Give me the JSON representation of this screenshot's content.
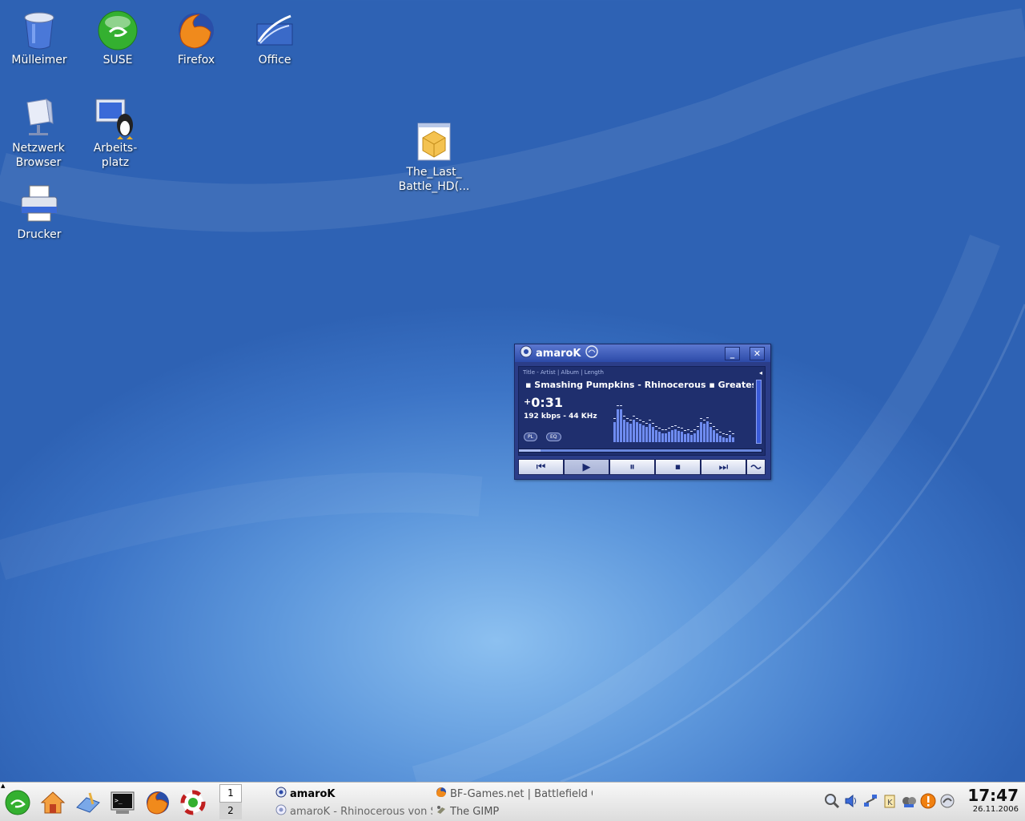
{
  "desktop_icons": [
    {
      "label": "Mülleimer",
      "icon": "trash-icon"
    },
    {
      "label": "SUSE",
      "icon": "suse-icon"
    },
    {
      "label": "Firefox",
      "icon": "firefox-icon"
    },
    {
      "label": "Office",
      "icon": "office-icon"
    },
    {
      "label": "Netzwerk\nBrowser",
      "icon": "network-browser-icon"
    },
    {
      "label": "Arbeits-\nplatz",
      "icon": "workstation-icon"
    },
    {
      "label": "Drucker",
      "icon": "printer-icon"
    },
    {
      "label": "The_Last_\nBattle_HD(...",
      "icon": "package-file-icon"
    }
  ],
  "amarok": {
    "title": "amaroK",
    "minimize": "_",
    "close": "✕",
    "columns": "Title - Artist | Album | Length",
    "track": "▪  Smashing Pumpkins - Rhinocerous  ▪  Greatest Hit",
    "time_prefix": "+",
    "time": "0:31",
    "bitrate": "192 kbps - 44 KHz",
    "pl_label": "PL",
    "eq_label": "EQ",
    "progress_fraction": 0.09,
    "analyzer_levels": [
      0.5,
      0.82,
      0.82,
      0.55,
      0.5,
      0.45,
      0.55,
      0.5,
      0.45,
      0.42,
      0.38,
      0.45,
      0.38,
      0.3,
      0.25,
      0.22,
      0.22,
      0.25,
      0.3,
      0.32,
      0.28,
      0.25,
      0.2,
      0.22,
      0.18,
      0.22,
      0.3,
      0.5,
      0.45,
      0.52,
      0.38,
      0.3,
      0.22,
      0.15,
      0.12,
      0.1,
      0.18,
      0.12
    ],
    "controls": [
      "⏮",
      "▶",
      "⏸",
      "⏹",
      "⏭"
    ]
  },
  "taskbar": {
    "pager": [
      "1",
      "2"
    ],
    "tasks": [
      {
        "label": "amaroK",
        "bold": true
      },
      {
        "label": "BF-Games.net | Battlefield Co",
        "bold": false
      },
      {
        "label": "amaroK - Rhinocerous von Sm",
        "bold": false
      },
      {
        "label": "The GIMP",
        "bold": false
      }
    ],
    "time": "17:47",
    "date": "26.11.2006"
  },
  "colors": {
    "accent": "#2c4aa8",
    "suse_green": "#3cb83c"
  }
}
